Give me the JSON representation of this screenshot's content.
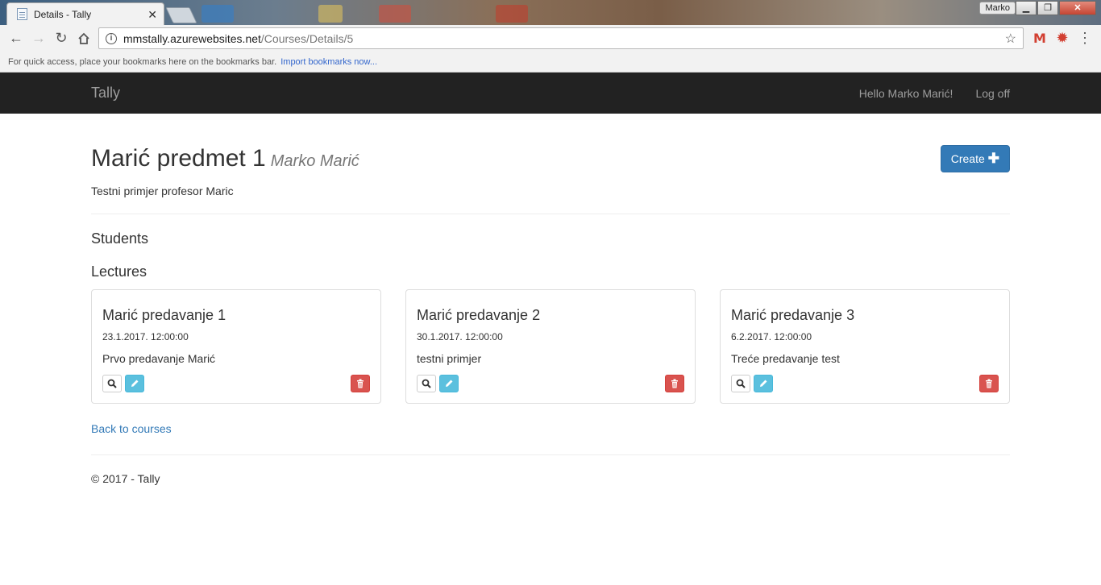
{
  "browser": {
    "tab_title": "Details - Tally",
    "tab_close": "✕",
    "user_name": "Marko",
    "window_minimize": "▁",
    "window_maximize": "❐",
    "window_close": "✕",
    "url_host": "mmstally.azurewebsites.net",
    "url_path": "/Courses/Details/5",
    "bookmarks_hint": "For quick access, place your bookmarks here on the bookmarks bar.",
    "bookmarks_import": "Import bookmarks now..."
  },
  "navbar": {
    "brand": "Tally",
    "greeting": "Hello Marko Marić!",
    "logoff": "Log off"
  },
  "course": {
    "title": "Marić predmet 1",
    "professor": "Marko Marić",
    "description": "Testni primjer profesor Maric",
    "create_label": "Create"
  },
  "sections": {
    "students": "Students",
    "lectures": "Lectures"
  },
  "lectures": [
    {
      "title": "Marić predavanje 1",
      "date": "23.1.2017. 12:00:00",
      "description": "Prvo predavanje Marić"
    },
    {
      "title": "Marić predavanje 2",
      "date": "30.1.2017. 12:00:00",
      "description": "testni primjer"
    },
    {
      "title": "Marić predavanje 3",
      "date": "6.2.2017. 12:00:00",
      "description": "Treće predavanje test"
    }
  ],
  "links": {
    "back": "Back to courses"
  },
  "footer": {
    "text": "© 2017 - Tally"
  },
  "colors": {
    "navbar_bg": "#222222",
    "primary": "#337ab7",
    "info": "#5bc0de",
    "danger": "#d9534f"
  }
}
